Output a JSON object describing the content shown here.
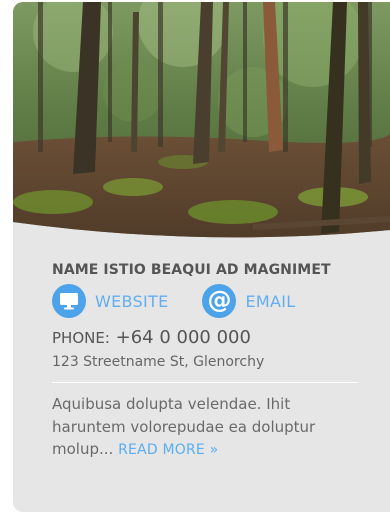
{
  "contact": {
    "name": "NAME ISTIO BEAQUI AD MAGNIMET",
    "website_label": "WEBSITE",
    "email_label": "EMAIL",
    "phone_label": "PHONE:",
    "phone_number": "+64 0 000 000",
    "address": "123 Streetname St, Glenorchy",
    "description": "Aquibusa dolupta velendae. Ihit haruntem volorepudae ea doluptur molup...",
    "read_more_label": "READ MORE »"
  },
  "icons": {
    "website": "monitor-icon",
    "email": "at-sign-icon"
  },
  "colors": {
    "card_background": "#e6e6e6",
    "accent_blue": "#4da3ea",
    "text_dark": "#555555"
  }
}
